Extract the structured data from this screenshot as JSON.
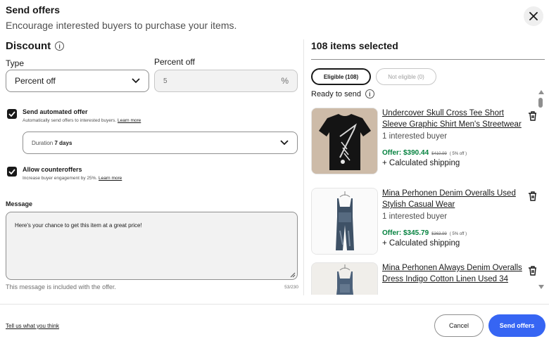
{
  "header": {
    "title": "Send offers",
    "subtitle": "Encourage interested buyers to purchase your items."
  },
  "discount": {
    "title": "Discount",
    "type_label": "Type",
    "type_value": "Percent off",
    "percent_label": "Percent off",
    "percent_value": "5",
    "percent_symbol": "%"
  },
  "automated": {
    "title": "Send automated offer",
    "desc": "Automatically send offers to interested buyers.",
    "learn_more": "Learn more",
    "checked": true
  },
  "duration": {
    "label": "Duration",
    "value": "7 days"
  },
  "counteroffers": {
    "title": "Allow counteroffers",
    "desc": "Increase buyer engagement by 25%.",
    "learn_more": "Learn more",
    "checked": true
  },
  "message": {
    "label": "Message",
    "text": "Here's your chance to get this item at a great price!",
    "help": "This message is included with the offer.",
    "count": "53/230"
  },
  "selection": {
    "count_text": "108 items selected",
    "tab_eligible": "Eligible (108)",
    "tab_not_eligible": "Not eligible (0)",
    "ready_label": "Ready to send"
  },
  "items": [
    {
      "title": "Undercover Skull Cross Tee Short Sleeve Graphic Shirt Men's Streetwear",
      "interest": "1 interested buyer",
      "offer": "Offer: $390.44",
      "original": "$410.99",
      "percent_off": "( 5% off )",
      "shipping": "+ Calculated shipping",
      "thumb_icon": "tshirt-thumbnail"
    },
    {
      "title": "Mina Perhonen Denim Overalls Used Stylish Casual Wear",
      "interest": "1 interested buyer",
      "offer": "Offer: $345.79",
      "original": "$363.99",
      "percent_off": "( 5% off )",
      "shipping": "+ Calculated shipping",
      "thumb_icon": "overalls-thumbnail"
    },
    {
      "title": "Mina Perhonen Always Denim Overalls Dress Indigo Cotton Linen Used 34",
      "interest": "",
      "offer": "",
      "original": "",
      "percent_off": "",
      "shipping": "",
      "thumb_icon": "overalls-dress-thumbnail"
    }
  ],
  "footer": {
    "feedback": "Tell us what you think",
    "cancel": "Cancel",
    "send": "Send offers"
  },
  "colors": {
    "primary": "#3665f3",
    "offer_green": "#05823f",
    "text": "#191919"
  }
}
